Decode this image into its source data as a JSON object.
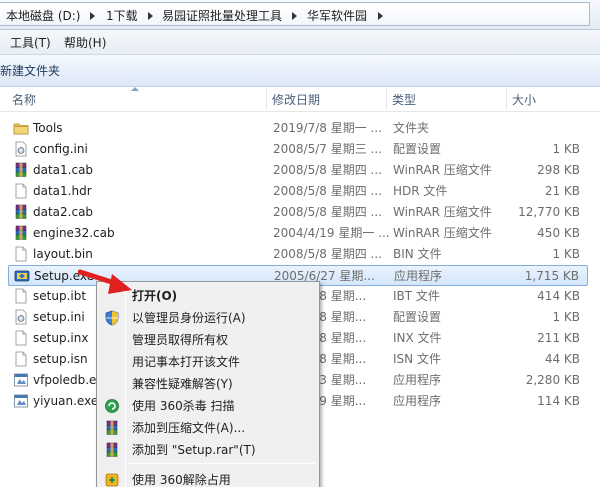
{
  "breadcrumb": [
    {
      "label": "本地磁盘 (D:)"
    },
    {
      "label": "1下载"
    },
    {
      "label": "易园证照批量处理工具"
    },
    {
      "label": "华军软件园"
    }
  ],
  "menubar": {
    "items": [
      {
        "label": "工具(T)"
      },
      {
        "label": "帮助(H)"
      }
    ]
  },
  "toolbar": {
    "new_folder_label": "新建文件夹"
  },
  "columns": {
    "name": "名称",
    "modified": "修改日期",
    "type": "类型",
    "size": "大小"
  },
  "files": [
    {
      "name": "Tools",
      "modified": "2019/7/8 星期一 ...",
      "type": "文件夹",
      "size": "",
      "icon": "folder-icon"
    },
    {
      "name": "config.ini",
      "modified": "2008/5/7 星期三 ...",
      "type": "配置设置",
      "size": "1 KB",
      "icon": "settings-file-icon"
    },
    {
      "name": "data1.cab",
      "modified": "2008/5/8 星期四 ...",
      "type": "WinRAR 压缩文件",
      "size": "298 KB",
      "icon": "winrar-icon"
    },
    {
      "name": "data1.hdr",
      "modified": "2008/5/8 星期四 ...",
      "type": "HDR 文件",
      "size": "21 KB",
      "icon": "file-icon"
    },
    {
      "name": "data2.cab",
      "modified": "2008/5/8 星期四 ...",
      "type": "WinRAR 压缩文件",
      "size": "12,770 KB",
      "icon": "winrar-icon"
    },
    {
      "name": "engine32.cab",
      "modified": "2004/4/19 星期一 ...",
      "type": "WinRAR 压缩文件",
      "size": "450 KB",
      "icon": "winrar-icon"
    },
    {
      "name": "layout.bin",
      "modified": "2008/5/8 星期四 ...",
      "type": "BIN 文件",
      "size": "1 KB",
      "icon": "file-icon"
    },
    {
      "name": "Setup.exe",
      "modified": "2005/6/27 星期...",
      "type": "应用程序",
      "size": "1,715 KB",
      "icon": "setup-exe-icon",
      "selected": true
    },
    {
      "name": "setup.ibt",
      "modified": "2008/5/8 星期...",
      "type": "IBT 文件",
      "size": "414 KB",
      "icon": "file-icon"
    },
    {
      "name": "setup.ini",
      "modified": "2008/5/8 星期...",
      "type": "配置设置",
      "size": "1 KB",
      "icon": "settings-file-icon"
    },
    {
      "name": "setup.inx",
      "modified": "2008/5/8 星期...",
      "type": "INX 文件",
      "size": "211 KB",
      "icon": "file-icon"
    },
    {
      "name": "setup.isn",
      "modified": "2008/5/8 星期...",
      "type": "ISN 文件",
      "size": "44 KB",
      "icon": "file-icon"
    },
    {
      "name": "vfpoledb.exe",
      "modified": "2008/5/3 星期...",
      "type": "应用程序",
      "size": "2,280 KB",
      "icon": "exe-icon"
    },
    {
      "name": "yiyuan.exe",
      "modified": "2008/5/9 星期...",
      "type": "应用程序",
      "size": "114 KB",
      "icon": "exe-icon"
    }
  ],
  "files_display": [
    {
      "modified": "2019/7/8 星期一 ..."
    },
    {
      "modified": "2008/5/7 星期三 ..."
    },
    {
      "modified": "2008/5/8 星期四 ..."
    },
    {
      "modified": "2008/5/8 星期四 ..."
    },
    {
      "modified": "2008/5/8 星期四 ..."
    },
    {
      "modified": "2004/4/19 星期一 ..."
    },
    {
      "modified": "2008/5/8 星期四 ..."
    },
    {
      "modified": "2005/6/27 星期..."
    },
    {
      "modified": "2008/5/8 星期..."
    },
    {
      "modified": "2008/5/8 星期..."
    },
    {
      "modified": "2008/5/8 星期..."
    },
    {
      "modified": "2008/5/8 星期..."
    },
    {
      "modified": "2008/5/3 星期..."
    },
    {
      "modified": "2008/5/9 星期..."
    }
  ],
  "context_menu": {
    "items": [
      {
        "label": "打开(O)",
        "bold": true,
        "icon": ""
      },
      {
        "label": "以管理员身份运行(A)",
        "icon": "uac-shield-icon"
      },
      {
        "label": "管理员取得所有权",
        "icon": ""
      },
      {
        "label": "用记事本打开该文件",
        "icon": ""
      },
      {
        "label": "兼容性疑难解答(Y)",
        "icon": ""
      },
      {
        "label": "使用 360杀毒 扫描",
        "icon": "360-antivirus-icon"
      },
      {
        "label": "添加到压缩文件(A)...",
        "icon": "winrar-icon"
      },
      {
        "label": "添加到 \"Setup.rar\"(T)",
        "icon": "winrar-icon"
      },
      {
        "label": "使用 360解除占用",
        "icon": "360-unlock-icon"
      }
    ]
  },
  "colors": {
    "selection_border": "#84acdd",
    "annotation_arrow": "#e0201e"
  }
}
